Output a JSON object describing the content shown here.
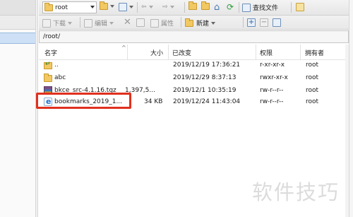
{
  "toolbar": {
    "location": "root",
    "find_files_label": "查找文件",
    "download_label": "下载",
    "edit_label": "编辑",
    "properties_label": "属性",
    "new_label": "新建"
  },
  "path": "/root/",
  "columns": {
    "name": "名字",
    "size": "大小",
    "modified": "已改变",
    "permissions": "权限",
    "owner": "拥有者"
  },
  "files": [
    {
      "icon": "parent-dir-icon",
      "name": "..",
      "size": "",
      "modified": "2019/12/19 17:36:21",
      "permissions": "r-xr-xr-x",
      "owner": "root"
    },
    {
      "icon": "folder-icon",
      "name": "abc",
      "size": "",
      "modified": "2019/12/29 8:37:13",
      "permissions": "rwxr-xr-x",
      "owner": "root"
    },
    {
      "icon": "archive-icon",
      "name": "bkce_src-4.1.16.tgz",
      "size": "1,397,5...",
      "modified": "2019/12/1 10:35:19",
      "permissions": "rw-r--r--",
      "owner": "root"
    },
    {
      "icon": "html-file-icon",
      "name": "bookmarks_2019_1...",
      "size": "34 KB",
      "modified": "2019/12/24 11:43:04",
      "permissions": "rw-r--r--",
      "owner": "root"
    }
  ],
  "highlight_color": "#e0301e",
  "watermark": "软件技巧"
}
